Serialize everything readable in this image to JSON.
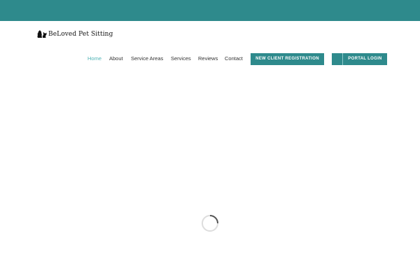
{
  "header": {
    "brand_name": "BeLoved Pet Sitting",
    "logo_icon": "dog-and-cat-silhouette-icon",
    "accent_color": "#2e8a8c",
    "active_link_color": "#4fb3b5"
  },
  "nav": {
    "items": [
      {
        "label": "Home",
        "active": true
      },
      {
        "label": "About",
        "active": false
      },
      {
        "label": "Service Areas",
        "active": false
      },
      {
        "label": "Services",
        "active": false
      },
      {
        "label": "Reviews",
        "active": false
      },
      {
        "label": "Contact",
        "active": false
      }
    ],
    "register_button": "NEW CLIENT REGISTRATION",
    "login_button": "PORTAL LOGIN"
  },
  "main": {
    "loading_icon": "loading-spinner-icon"
  }
}
